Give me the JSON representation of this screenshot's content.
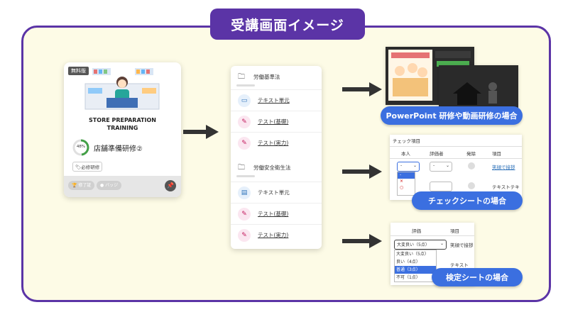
{
  "title": "受講画面イメージ",
  "card": {
    "free_badge": "無料版",
    "store_title_1": "STORE PREPARATION",
    "store_title_2": "TRAINING",
    "progress_pct": "48%",
    "progress_value": 48,
    "course_name": "店舗準備研修②",
    "tag": "必修研修",
    "pill_1": "修了証",
    "pill_2": "バッジ"
  },
  "list": {
    "section1": "労働基準法",
    "section2": "労働安全衛生法",
    "items1": [
      "テキスト単元",
      "テスト(基礎)",
      "テスト(実力)"
    ],
    "items2": [
      "テキスト単元",
      "テスト(基礎)",
      "テスト(実力)"
    ]
  },
  "captions": {
    "powerpoint": "PowerPoint 研修や動画研修の場合",
    "check": "チェックシートの場合",
    "exam": "検定シートの場合"
  },
  "check_sheet": {
    "title": "チェック項目",
    "headers": [
      "本人",
      "評価者",
      "発除",
      "項目"
    ],
    "row_item_1": "笑顔で接拶",
    "row_item_2": "テキストテキ",
    "select_value": "-",
    "options": [
      "-",
      "×",
      "○"
    ]
  },
  "exam_sheet": {
    "headers": [
      "評価",
      "項目"
    ],
    "select_value": "大変良い（5点）",
    "row_item_1": "笑顔で接拶",
    "row_item_2": "テキスト",
    "options": [
      "大変良い（5点）",
      "良い（4点）",
      "普通（3点）",
      "不可（1点）"
    ]
  },
  "colors": {
    "accent": "#5b34a6",
    "caption": "#3b6fe0",
    "background": "#fdfbe6"
  }
}
